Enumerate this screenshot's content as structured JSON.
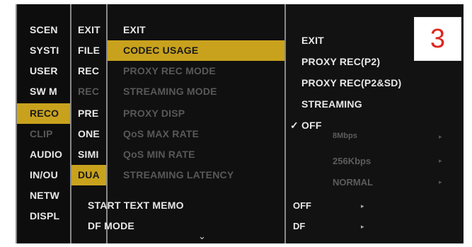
{
  "menu_level1": [
    "SCEN",
    "SYSTI",
    "USER",
    "SW M",
    "RECO",
    "CLIP",
    "AUDIO",
    "IN/OU",
    "NETW",
    "DISPL"
  ],
  "menu_level2": [
    "EXIT",
    "FILE",
    "REC",
    "REC",
    "PRE",
    "ONE",
    "SIMI",
    "DUA"
  ],
  "menu_level3": {
    "items": [
      "EXIT",
      "CODEC USAGE",
      "PROXY REC MODE",
      "STREAMING MODE",
      "PROXY DISP",
      "QoS MAX RATE",
      "QoS MIN RATE",
      "STREAMING LATENCY"
    ],
    "start_text_memo": "START TEXT MEMO",
    "df_mode": "DF MODE"
  },
  "values": {
    "qos_max": "8Mbps",
    "qos_min": "256Kbps",
    "latency": "NORMAL",
    "start_text_memo": "OFF",
    "df_mode": "DF"
  },
  "submenu": [
    "EXIT",
    "PROXY REC(P2)",
    "PROXY REC(P2&SD)",
    "STREAMING",
    "OFF"
  ],
  "checkmark": "✓",
  "badge": "3",
  "colors": {
    "highlight": "#c9a21d",
    "background": "#0b0b0b",
    "badge_text": "#e0261e"
  }
}
